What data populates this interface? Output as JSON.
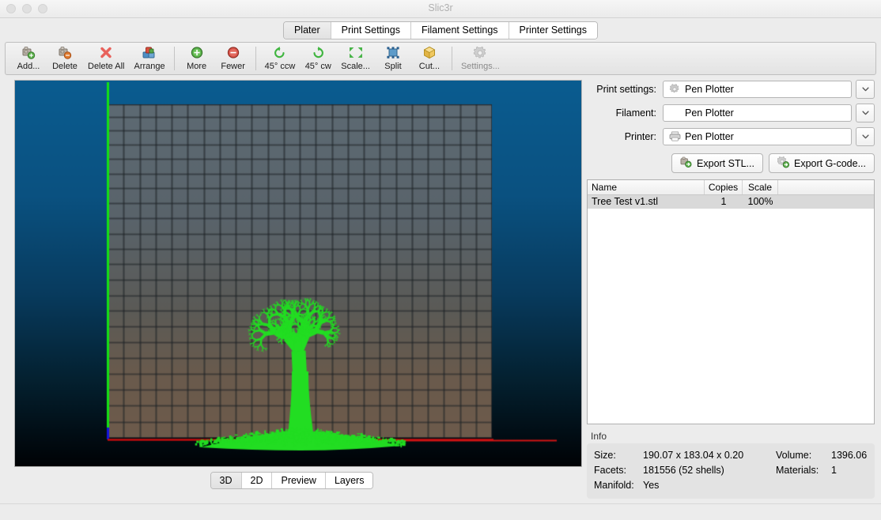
{
  "window": {
    "title": "Slic3r",
    "traffic_lights": [
      "close-button",
      "minimize-button",
      "zoom-button"
    ]
  },
  "tabs": [
    {
      "label": "Plater",
      "active": true
    },
    {
      "label": "Print Settings",
      "active": false
    },
    {
      "label": "Filament Settings",
      "active": false
    },
    {
      "label": "Printer Settings",
      "active": false
    }
  ],
  "toolbar": [
    {
      "label": "Add...",
      "icon": "add-object-icon",
      "name": "toolbar-add"
    },
    {
      "label": "Delete",
      "icon": "delete-object-icon",
      "name": "toolbar-delete"
    },
    {
      "label": "Delete All",
      "icon": "delete-all-icon",
      "name": "toolbar-delete-all"
    },
    {
      "label": "Arrange",
      "icon": "arrange-icon",
      "name": "toolbar-arrange"
    },
    {
      "label": "SEP",
      "icon": "separator",
      "name": "toolbar-separator-1"
    },
    {
      "label": "More",
      "icon": "plus-circle-icon",
      "name": "toolbar-more"
    },
    {
      "label": "Fewer",
      "icon": "minus-circle-icon",
      "name": "toolbar-fewer"
    },
    {
      "label": "SEP",
      "icon": "separator",
      "name": "toolbar-separator-2"
    },
    {
      "label": "45° ccw",
      "icon": "rotate-ccw-icon",
      "name": "toolbar-rotate-ccw"
    },
    {
      "label": "45° cw",
      "icon": "rotate-cw-icon",
      "name": "toolbar-rotate-cw"
    },
    {
      "label": "Scale...",
      "icon": "scale-icon",
      "name": "toolbar-scale"
    },
    {
      "label": "Split",
      "icon": "split-icon",
      "name": "toolbar-split"
    },
    {
      "label": "Cut...",
      "icon": "cut-icon",
      "name": "toolbar-cut"
    },
    {
      "label": "SEP",
      "icon": "separator",
      "name": "toolbar-separator-3"
    },
    {
      "label": "Settings...",
      "icon": "gear-icon",
      "name": "toolbar-settings"
    }
  ],
  "presets": [
    {
      "label": "Print settings:",
      "value": "Pen Plotter",
      "icon": "print-settings-gear-icon",
      "name": "print-settings"
    },
    {
      "label": "Filament:",
      "value": "Pen Plotter",
      "icon": "none",
      "name": "filament"
    },
    {
      "label": "Printer:",
      "value": "Pen Plotter",
      "icon": "printer-icon",
      "name": "printer"
    }
  ],
  "export_buttons": [
    {
      "label": "Export STL...",
      "icon": "export-stl-icon",
      "name": "export-stl-button"
    },
    {
      "label": "Export G-code...",
      "icon": "export-gcode-icon",
      "name": "export-gcode-button"
    }
  ],
  "object_list": {
    "columns": [
      "Name",
      "Copies",
      "Scale"
    ],
    "rows": [
      {
        "name": "Tree Test v1.stl",
        "copies": "1",
        "scale": "100%",
        "selected": true
      }
    ]
  },
  "info": {
    "title": "Info",
    "size_key": "Size:",
    "size_value": "190.07 x 183.04 x 0.20",
    "volume_key": "Volume:",
    "volume_value": "1396.06",
    "facets_key": "Facets:",
    "facets_value": "181556 (52 shells)",
    "materials_key": "Materials:",
    "materials_value": "1",
    "manifold_key": "Manifold:",
    "manifold_value": "Yes"
  },
  "view_tabs": [
    {
      "label": "3D",
      "active": true
    },
    {
      "label": "2D",
      "active": false
    },
    {
      "label": "Preview",
      "active": false
    },
    {
      "label": "Layers",
      "active": false
    }
  ],
  "viewport": {
    "model_color": "#22dd22",
    "bg_top": "#0b5a8c",
    "bg_bottom": "#000000",
    "bed_color": "#5e6a72",
    "axis_x_color": "#cc0000",
    "axis_y_color": "#00cc00",
    "axis_z_color": "#0000cc"
  }
}
